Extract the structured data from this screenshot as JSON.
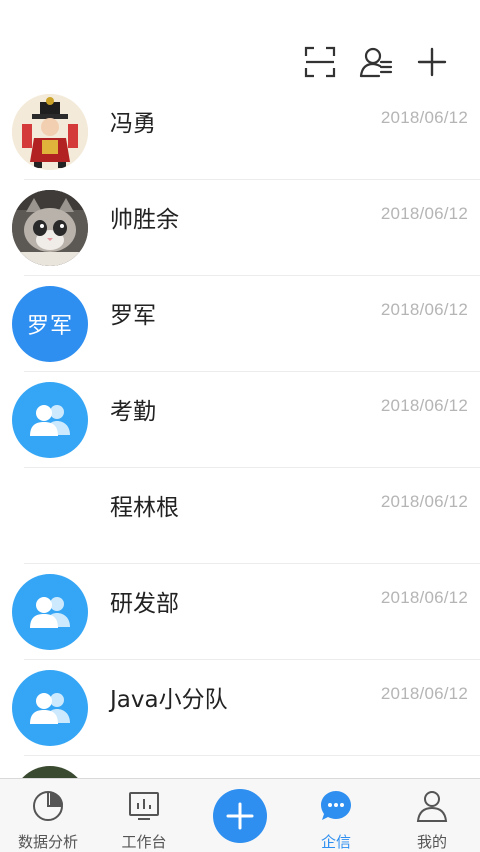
{
  "header": {
    "icons": [
      "scan-icon",
      "contacts-icon",
      "add-icon"
    ]
  },
  "conversations": [
    {
      "name": "冯勇",
      "date": "2018/06/12",
      "avatar": "photo-cartoon"
    },
    {
      "name": "帅胜余",
      "date": "2018/06/12",
      "avatar": "photo-cat"
    },
    {
      "name": "罗军",
      "date": "2018/06/12",
      "avatar_text": "罗军"
    },
    {
      "name": "考勤",
      "date": "2018/06/12",
      "avatar": "group-icon"
    },
    {
      "name": "程林根",
      "date": "2018/06/12",
      "avatar": "none"
    },
    {
      "name": "研发部",
      "date": "2018/06/12",
      "avatar": "group-icon"
    },
    {
      "name": "Java小分队",
      "date": "2018/06/12",
      "avatar": "group-icon"
    }
  ],
  "tabbar": {
    "tabs": [
      {
        "label": "数据分析",
        "icon": "pie-chart-icon"
      },
      {
        "label": "工作台",
        "icon": "monitor-chart-icon"
      },
      {
        "label": "",
        "icon": "plus-icon"
      },
      {
        "label": "企信",
        "icon": "chat-bubble-icon",
        "active": true
      },
      {
        "label": "我的",
        "icon": "person-icon"
      }
    ],
    "active_color": "#2e8ff0"
  },
  "colors": {
    "accent": "#2e8ff0",
    "group_avatar": "#35a6f5",
    "date_text": "#b5b5b5"
  }
}
